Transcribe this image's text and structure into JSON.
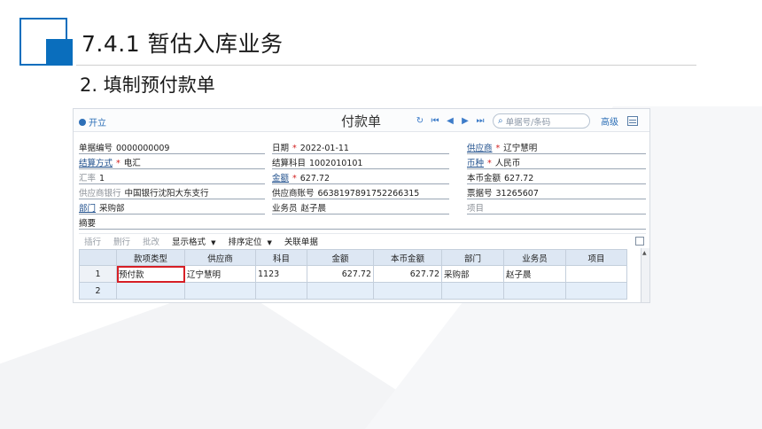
{
  "slide": {
    "title": "7.4.1  暂估入库业务",
    "subtitle": "2. 填制预付款单",
    "accent_color": "#0a6ebd"
  },
  "toolbar": {
    "open_label": "开立",
    "doc_title": "付款单",
    "search_placeholder": "单据号/条码",
    "advanced_label": "高级",
    "icons": [
      "refresh-icon",
      "first-icon",
      "prev-icon",
      "next-icon",
      "last-icon",
      "search-icon",
      "grid-settings-icon"
    ]
  },
  "form": {
    "doc_no": {
      "label": "单据编号",
      "value": "0000000009"
    },
    "date": {
      "label": "日期",
      "value": "2022-01-11"
    },
    "supplier": {
      "label": "供应商",
      "value": "辽宁慧明"
    },
    "settle_method": {
      "label": "结算方式",
      "value": "电汇"
    },
    "settle_subject": {
      "label": "结算科目",
      "value": "1002010101"
    },
    "currency": {
      "label": "币种",
      "value": "人民币"
    },
    "rate": {
      "label": "汇率",
      "value": "1"
    },
    "amount": {
      "label": "金额",
      "value": "627.72"
    },
    "local_amount": {
      "label": "本币金额",
      "value": "627.72"
    },
    "supplier_bank": {
      "label": "供应商银行",
      "value": "中国银行沈阳大东支行"
    },
    "supplier_account": {
      "label": "供应商账号",
      "value": "6638197891752266315"
    },
    "bill_no": {
      "label": "票据号",
      "value": "31265607"
    },
    "department": {
      "label": "部门",
      "value": "采购部"
    },
    "salesman": {
      "label": "业务员",
      "value": "赵子晨"
    },
    "project": {
      "label": "项目",
      "value": ""
    },
    "memo": {
      "label": "摘要",
      "value": ""
    }
  },
  "grid_toolbar": {
    "insert": "插行",
    "delete": "删行",
    "batch": "批改",
    "display_format": "显示格式",
    "sort": "排序定位",
    "related": "关联单据"
  },
  "grid": {
    "headers": [
      "款项类型",
      "供应商",
      "科目",
      "金额",
      "本币金额",
      "部门",
      "业务员",
      "项目"
    ],
    "rows": [
      {
        "no": "1",
        "type": "预付款",
        "supplier": "辽宁慧明",
        "subject": "1123",
        "amount": "627.72",
        "local_amount": "627.72",
        "dept": "采购部",
        "salesman": "赵子晨",
        "project": ""
      },
      {
        "no": "2",
        "type": "",
        "supplier": "",
        "subject": "",
        "amount": "",
        "local_amount": "",
        "dept": "",
        "salesman": "",
        "project": ""
      }
    ]
  }
}
